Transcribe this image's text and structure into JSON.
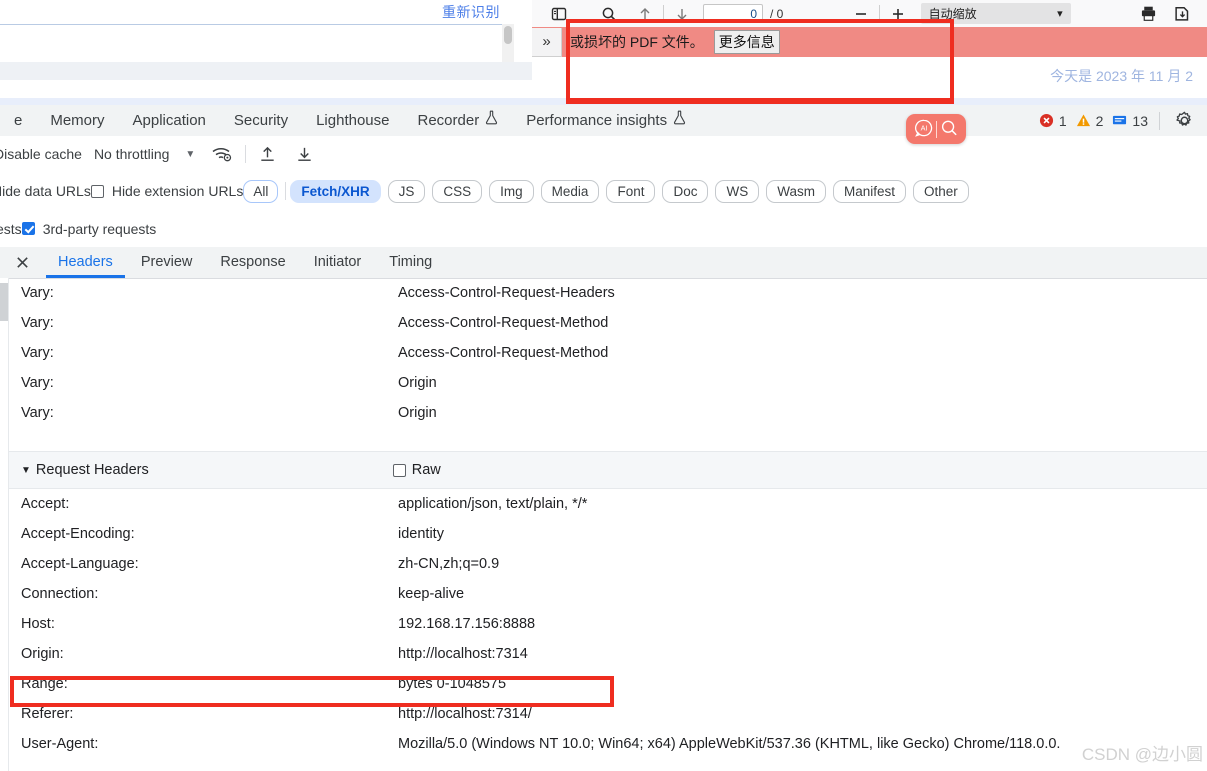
{
  "page_remnant": {
    "recognize_link": "重新识别"
  },
  "pdf_viewer": {
    "page_number": "0",
    "page_total": "/ 0",
    "zoom_label": "自动缩放",
    "banner_text": "或损坏的 PDF 文件。",
    "banner_button": "更多信息",
    "date_text": "今天是 2023 年 11 月 2",
    "icons": {
      "sidebar": "sidebar-toggle-icon",
      "search": "search-icon",
      "prev": "arrow-up-icon",
      "next": "arrow-down-icon",
      "zoom_out": "minus-icon",
      "zoom_in": "plus-icon",
      "print": "print-icon",
      "save": "save-icon",
      "more": "chevron-double-right-icon"
    }
  },
  "devtools": {
    "tabs": [
      {
        "label": "e",
        "flask": false
      },
      {
        "label": "Memory",
        "flask": false
      },
      {
        "label": "Application",
        "flask": false
      },
      {
        "label": "Security",
        "flask": false
      },
      {
        "label": "Lighthouse",
        "flask": false
      },
      {
        "label": "Recorder",
        "flask": true
      },
      {
        "label": "Performance insights",
        "flask": true
      }
    ],
    "status": {
      "errors": "1",
      "warnings": "2",
      "messages": "13"
    },
    "ai_pill": {
      "ai_icon": "ai-bubble-icon",
      "search_icon": "search-icon"
    },
    "toolbar_row1": {
      "disable_cache": "Disable cache",
      "throttling": "No throttling",
      "wifi_icon": "wifi-settings-icon",
      "import_icon": "import-har-icon",
      "export_icon": "export-har-icon"
    },
    "toolbar_row2": {
      "hide_data_urls": "Hide data URLs",
      "hide_extension_urls": "Hide extension URLs",
      "hide_extension_checked": false,
      "chips": [
        {
          "label": "All",
          "selected": false
        },
        {
          "label": "Fetch/XHR",
          "selected": true
        },
        {
          "label": "JS",
          "selected": false
        },
        {
          "label": "CSS",
          "selected": false
        },
        {
          "label": "Img",
          "selected": false
        },
        {
          "label": "Media",
          "selected": false
        },
        {
          "label": "Font",
          "selected": false
        },
        {
          "label": "Doc",
          "selected": false
        },
        {
          "label": "WS",
          "selected": false
        },
        {
          "label": "Wasm",
          "selected": false
        },
        {
          "label": "Manifest",
          "selected": false
        },
        {
          "label": "Other",
          "selected": false
        }
      ]
    },
    "toolbar_row3": {
      "requests_label": "ests",
      "third_party": "3rd-party requests",
      "third_party_checked": true
    }
  },
  "request_pane": {
    "close_icon": "close-icon",
    "tabs": [
      {
        "label": "Headers",
        "active": true
      },
      {
        "label": "Preview",
        "active": false
      },
      {
        "label": "Response",
        "active": false
      },
      {
        "label": "Initiator",
        "active": false
      },
      {
        "label": "Timing",
        "active": false
      }
    ],
    "response_headers": [
      {
        "key": "Vary:",
        "value": "Access-Control-Request-Headers"
      },
      {
        "key": "Vary:",
        "value": "Access-Control-Request-Method"
      },
      {
        "key": "Vary:",
        "value": "Access-Control-Request-Method"
      },
      {
        "key": "Vary:",
        "value": "Origin"
      },
      {
        "key": "Vary:",
        "value": "Origin"
      }
    ],
    "request_headers_section": {
      "title": "Request Headers",
      "raw_label": "Raw",
      "raw_checked": false
    },
    "request_headers": [
      {
        "key": "Accept:",
        "value": "application/json, text/plain, */*"
      },
      {
        "key": "Accept-Encoding:",
        "value": "identity"
      },
      {
        "key": "Accept-Language:",
        "value": "zh-CN,zh;q=0.9"
      },
      {
        "key": "Connection:",
        "value": "keep-alive"
      },
      {
        "key": "Host:",
        "value": "192.168.17.156:8888"
      },
      {
        "key": "Origin:",
        "value": "http://localhost:7314"
      },
      {
        "key": "Range:",
        "value": "bytes 0-1048575"
      },
      {
        "key": "Referer:",
        "value": "http://localhost:7314/"
      },
      {
        "key": "User-Agent:",
        "value": "Mozilla/5.0 (Windows NT 10.0; Win64; x64) AppleWebKit/537.36 (KHTML, like Gecko) Chrome/118.0.0."
      }
    ]
  },
  "annotations": {
    "highlight_color": "#ef2d20"
  },
  "watermark": "CSDN @边小圆"
}
